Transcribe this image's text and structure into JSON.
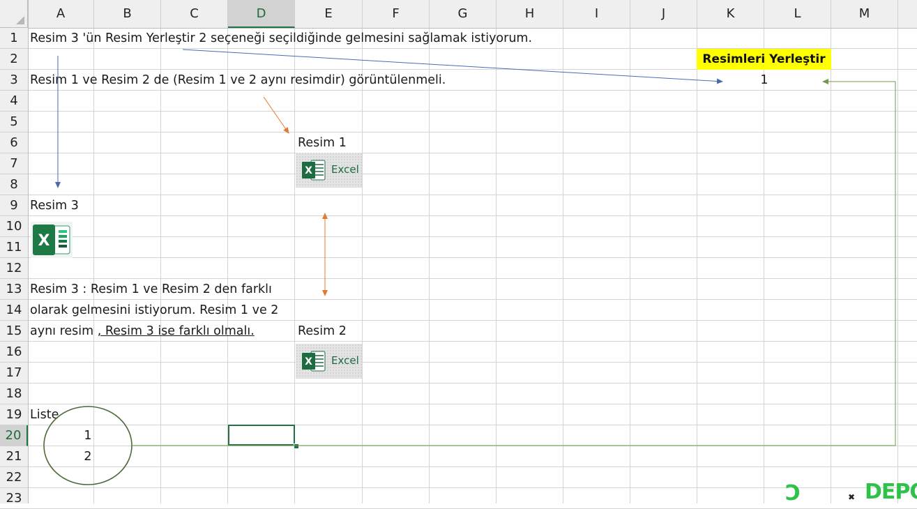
{
  "sheet": {
    "columns": [
      "A",
      "B",
      "C",
      "D",
      "E",
      "F",
      "G",
      "H",
      "I",
      "J",
      "K",
      "L",
      "M"
    ],
    "rows": [
      "1",
      "2",
      "3",
      "4",
      "5",
      "6",
      "7",
      "8",
      "9",
      "10",
      "11",
      "12",
      "13",
      "14",
      "15",
      "16",
      "17",
      "18",
      "19",
      "20",
      "21",
      "22",
      "23"
    ],
    "selected_column": "D",
    "selected_row": "20"
  },
  "cells": {
    "a1": "Resim 3 'ün Resim Yerleştir 2 seçeneği seçildiğinde gelmesini sağlamak istiyorum.",
    "a3": "Resim 1 ve Resim 2 de (Resim 1 ve 2 aynı resimdir) görüntülenmeli.",
    "e6": "Resim 1",
    "a9": "Resim 3",
    "a13": "Resim 3 : Resim 1 ve Resim 2 den farklı",
    "a14": "olarak gelmesini istiyorum. Resim 1 ve 2",
    "a15_plain": "aynı resim ",
    "a15_underlined": ", Resim 3 ise farklı olmalı.",
    "e15": "Resim 2",
    "a19": "Liste",
    "b20": "1",
    "b21": "2",
    "k2": "Resimleri Yerleştir",
    "l3": "1"
  },
  "images": {
    "excel_label": "Excel"
  },
  "colors": {
    "accent": "#217346",
    "badge_bg": "#ffff00",
    "arrow_blue": "#4a6ab0",
    "arrow_orange": "#e07b33",
    "arrow_green": "#6f9a4a",
    "circle": "#4c6a3a"
  },
  "watermark": {
    "text": "DEPO"
  }
}
